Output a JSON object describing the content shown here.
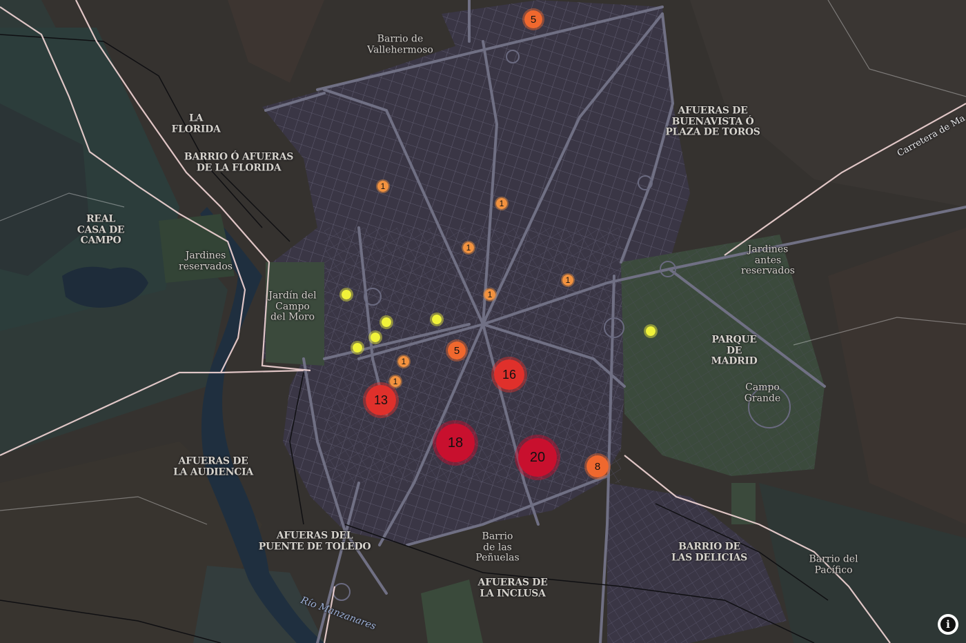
{
  "map": {
    "labels": [
      {
        "text": "Barrio de\nVallehermoso",
        "style": "small"
      },
      {
        "text": "LA\nFLORIDA",
        "style": "caps"
      },
      {
        "text": "BARRIO Ó AFUERAS\nDE LA FLORIDA",
        "style": "caps"
      },
      {
        "text": "AFUERAS DE\nBUENAVISTA Ó\nPLAZA DE TOROS",
        "style": "caps"
      },
      {
        "text": "Carretera de Ma",
        "style": "road"
      },
      {
        "text": "REAL\nCASA DE\nCAMPO",
        "style": "caps"
      },
      {
        "text": "Jardines\nreservados",
        "style": "small"
      },
      {
        "text": "Jardín del\nCampo\ndel Moro",
        "style": "small"
      },
      {
        "text": "Jardines\nantes\nreservados",
        "style": "small"
      },
      {
        "text": "PARQUE\nDE\nMADRID",
        "style": "caps"
      },
      {
        "text": "Campo\nGrande",
        "style": "small"
      },
      {
        "text": "AFUERAS DE\nLA AUDIENCIA",
        "style": "caps"
      },
      {
        "text": "AFUERAS DEL\nPUENTE DE TOLEDO",
        "style": "caps"
      },
      {
        "text": "Barrio\nde las\nPeñuelas",
        "style": "small"
      },
      {
        "text": "AFUERAS DE\nLA INCLUSA",
        "style": "caps"
      },
      {
        "text": "BARRIO DE\nLAS DELICIAS",
        "style": "caps"
      },
      {
        "text": "Barrio del\nPacífico",
        "style": "small"
      },
      {
        "text": "Río Manzanares",
        "style": "river"
      }
    ],
    "clusters": [
      {
        "count": "5"
      },
      {
        "count": "1"
      },
      {
        "count": "1"
      },
      {
        "count": "1"
      },
      {
        "count": "1"
      },
      {
        "count": "1"
      },
      {
        "count": "5"
      },
      {
        "count": "1"
      },
      {
        "count": "1"
      },
      {
        "count": "16"
      },
      {
        "count": "13"
      },
      {
        "count": "18"
      },
      {
        "count": "20"
      },
      {
        "count": "8"
      }
    ],
    "points_count": 6,
    "colors": {
      "cluster_small": "#f2923f",
      "cluster_medium": "#f0682e",
      "cluster_large": "#e0302b",
      "cluster_xlarge": "#c8102e",
      "point": "#f0f23a",
      "boundary": "#f3d6d6"
    }
  },
  "controls": {
    "info_icon": "info-icon",
    "info_glyph": "i"
  }
}
